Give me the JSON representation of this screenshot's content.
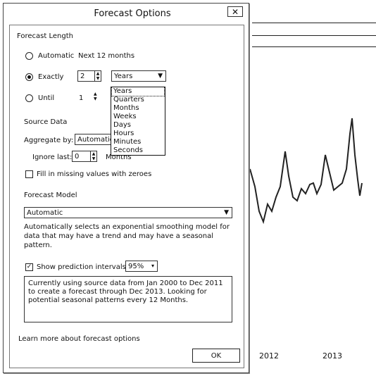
{
  "background": {
    "axis_labels": [
      "2012",
      "2013"
    ]
  },
  "dialog": {
    "title": "Forecast Options",
    "close_label": "✕",
    "forecast_length": {
      "heading": "Forecast Length",
      "automatic": {
        "label": "Automatic",
        "hint": "Next 12 months",
        "checked": false
      },
      "exactly": {
        "label": "Exactly",
        "value": "2",
        "unit": "Years",
        "checked": true
      },
      "until": {
        "label": "Until",
        "value": "1",
        "checked": false
      }
    },
    "unit_options": [
      "Years",
      "Quarters",
      "Months",
      "Weeks",
      "Days",
      "Hours",
      "Minutes",
      "Seconds"
    ],
    "source_data": {
      "heading": "Source Data",
      "aggregate_label": "Aggregate by:",
      "aggregate_value": "Automatic",
      "ignore_label": "Ignore last:",
      "ignore_value": "0",
      "ignore_unit": "Months",
      "fill_label": "Fill in missing values with zeroes",
      "fill_checked": false
    },
    "forecast_model": {
      "heading": "Forecast Model",
      "value": "Automatic",
      "description": "Automatically selects an exponential smoothing model for data that may have a trend and may have a seasonal pattern."
    },
    "prediction": {
      "label": "Show prediction intervals",
      "checked": true,
      "value": "95%"
    },
    "summary": "Currently using source data from Jan 2000 to Dec 2011 to create a forecast through Dec 2013. Looking for potential seasonal patterns every 12 Months.",
    "learn_more": "Learn more about forecast options",
    "ok_label": "OK"
  }
}
